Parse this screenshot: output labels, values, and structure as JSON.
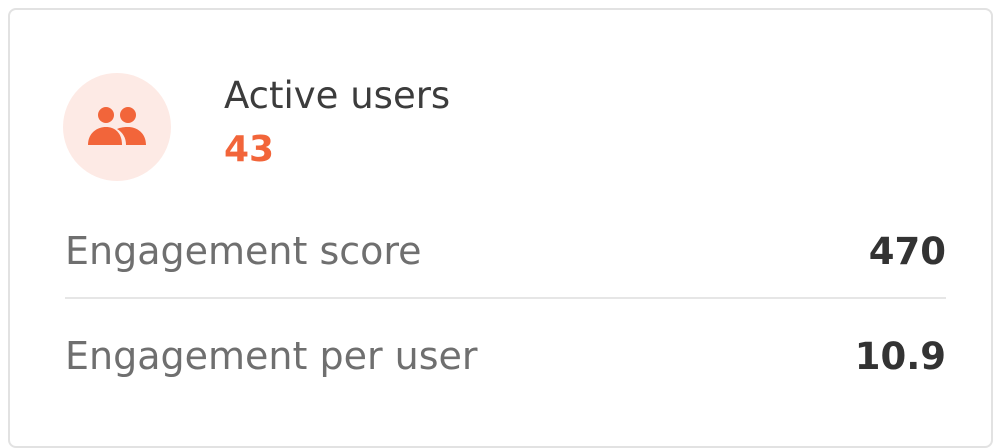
{
  "card": {
    "title": "Active users",
    "value": "43",
    "icon": "users-group-icon",
    "accent_color": "#f2653a",
    "icon_bg_color": "#fdeae5"
  },
  "metrics": [
    {
      "label": "Engagement score",
      "value": "470"
    },
    {
      "label": "Engagement per user",
      "value": "10.9"
    }
  ]
}
